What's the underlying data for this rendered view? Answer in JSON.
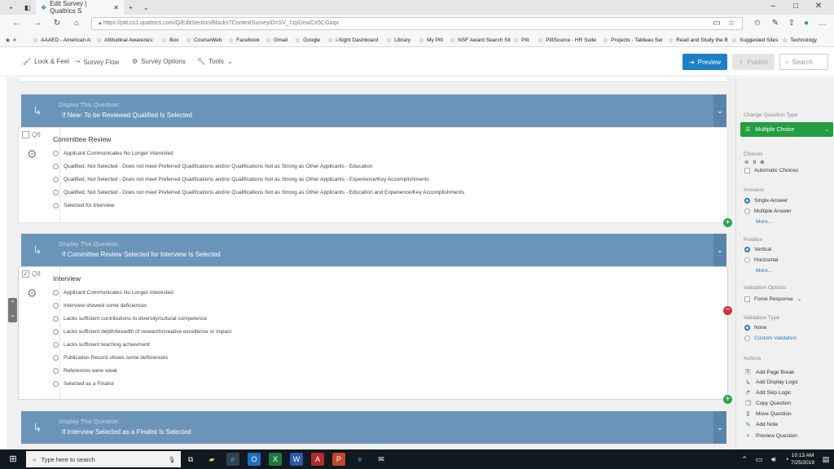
{
  "browser": {
    "tab_title": "Edit Survey | Qualtrics S",
    "url": "https://pitt.co1.qualtrics.com/Q/EditSection/Blocks?ContextSurveyID=SV_7zpGnwCX5CGaqx",
    "favorites": [
      "AAAED - American A:",
      "Attitudinal Awarenes:",
      "Box",
      "CourseWeb",
      "Facebook",
      "Gmail",
      "Google",
      "i-Sight  Dashboard",
      "Library",
      "My Pitt",
      "NSF Award Search Sit",
      "Pitt",
      "PittSource - HR Suite",
      "Projects - Tableau Ser",
      "Read and Study the B",
      "Suggested Sites",
      "Technology"
    ]
  },
  "toolbar": {
    "look_feel": "Look & Feel",
    "survey_flow": "Survey Flow",
    "survey_options": "Survey Options",
    "tools": "Tools",
    "preview": "Preview",
    "publish": "Publish",
    "search": "Search"
  },
  "blocks": [
    {
      "logic_label": "Display This Question:",
      "logic_condition": "If New- To be Reviewed Qualified Is Selected",
      "qnum": "Q6",
      "title": "Committee Review",
      "options": [
        "Applicant Communicates No Longer Interested",
        "Qualified, Not Selected - Does not meet Preferred Qualifications and/or Qualifications Not as Strong as Other Applicants - Education",
        "Qualified, Not Selected - Does not meet Preferred Qualifications and/or Qualifications Not as Strong as Other Applicants - Experience/Key Accomplishments",
        "Qualified, Not Selected - Does not meet Preferred Qualifications and/or Qualifications Not as Strong as Other Applicants - Education and Experience/Key Accomplishments",
        "Selected for Interview"
      ]
    },
    {
      "logic_label": "Display This Question:",
      "logic_condition": "If Committee Review Selected for Interview Is Selected",
      "qnum": "Q8",
      "title": "Interview",
      "options": [
        "Applicant Communicates No Longer Interested",
        "Interview showed some deficiences",
        "Lacks sufficient contributions to diversity/cultural competence",
        "Lacks sufficient depth/breadth of research/creative excellence or impact",
        "Lacks sufficient teaching achievment",
        "Publication Record shows some deficiencies",
        "References were weak",
        "Selected as a Finalist"
      ]
    },
    {
      "logic_label": "Display This Question:",
      "logic_condition": "If Interview Selected as a Finalist Is Selected"
    }
  ],
  "panel": {
    "change_type": "Change Question Type",
    "type_value": "Multiple Choice",
    "choices_label": "Choices",
    "choices_count": "8",
    "auto_choices": "Automatic Choices",
    "answers_label": "Answers",
    "single": "Single Answer",
    "multiple": "Multiple Answer",
    "more": "More...",
    "position_label": "Position",
    "vertical": "Vertical",
    "horizontal": "Horizontal",
    "validation_options": "Validation Options",
    "force_response": "Force Response",
    "validation_type": "Validation Type",
    "none": "None",
    "custom_validation": "Custom Validation",
    "actions_label": "Actions",
    "actions": [
      "Add Page Break",
      "Add Display Logic",
      "Add Skip Logic",
      "Copy Question",
      "Move Question",
      "Add Note",
      "Preview Question"
    ]
  },
  "taskbar": {
    "search_placeholder": "Type here to search",
    "time": "10:13 AM",
    "date": "7/25/2019"
  }
}
